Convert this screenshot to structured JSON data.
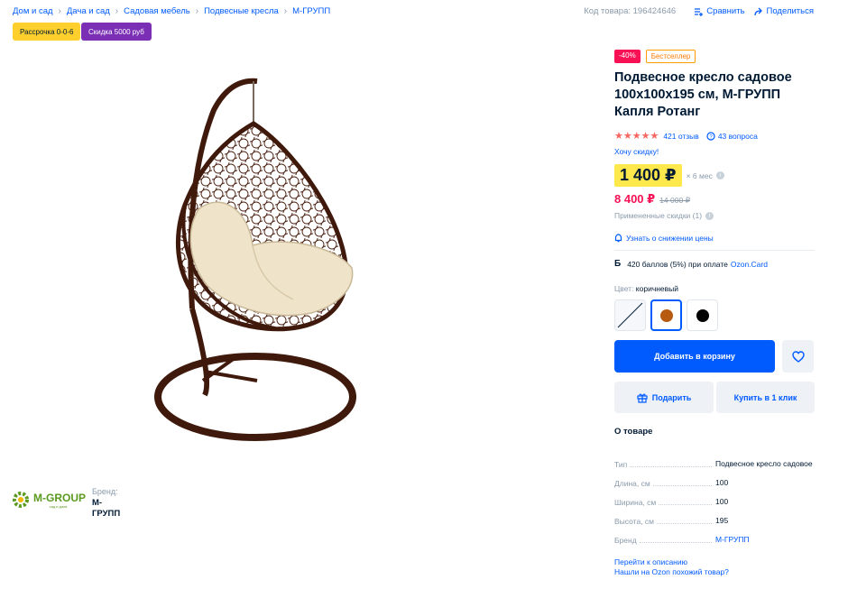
{
  "breadcrumbs": [
    "Дом и сад",
    "Дача и сад",
    "Садовая мебель",
    "Подвесные кресла",
    "М-ГРУПП"
  ],
  "top_actions": {
    "product_code": "Код товара: 196424646",
    "compare": "Сравнить",
    "share": "Поделиться"
  },
  "promos": {
    "installment": "Рассрочка 0-0-6",
    "discount": "Скидка 5000 руб"
  },
  "brand": {
    "logo_text": "M-GROUP",
    "logo_subtitle": "сад и дача",
    "label": "Бренд:",
    "name": "М-ГРУПП"
  },
  "product": {
    "badges": {
      "sale": "-40%",
      "bestseller": "Бестселлер"
    },
    "title": "Подвесное кресло садовое 100х100х195 см, М-ГРУПП Капля Ротанг",
    "rating_stars": 5,
    "reviews": "421 отзыв",
    "questions": "43 вопроса",
    "want_discount": "Хочу скидку!",
    "price_installment": "1 400 ₽",
    "installment_period": "× 6 мес",
    "price_sale": "8 400 ₽",
    "price_old": "14 000 ₽",
    "applied_discounts": "Примененные скидки (1)",
    "notify_price": "Узнать о снижении цены",
    "points_text": "420 баллов (5%) при оплате",
    "points_link": "Ozon.Card",
    "color_label": "Цвет:",
    "color_value": "коричневый",
    "colors": [
      {
        "name": "none",
        "hex": ""
      },
      {
        "name": "brown",
        "hex": "#b55a10"
      },
      {
        "name": "black",
        "hex": "#000000"
      }
    ],
    "add_to_cart": "Добавить в корзину",
    "gift": "Подарить",
    "buy_one_click": "Купить в 1 клик"
  },
  "about": {
    "title": "О товаре",
    "specs": [
      {
        "key": "Тип",
        "value": "Подвесное кресло садовое"
      },
      {
        "key": "Длина, см",
        "value": "100"
      },
      {
        "key": "Ширина, см",
        "value": "100"
      },
      {
        "key": "Высота, см",
        "value": "195"
      },
      {
        "key": "Бренд",
        "value": "М-ГРУПП"
      }
    ],
    "go_to_description": "Перейти к описанию",
    "found_cheaper": "Нашли на Ozon похожий товар?"
  },
  "colors": {
    "accent": "#005bff",
    "sale": "#f91155",
    "price_highlight": "#ffe84b",
    "installment_badge": "#ffd02d",
    "discount_badge": "#7b2fb5",
    "star": "#f86660"
  }
}
